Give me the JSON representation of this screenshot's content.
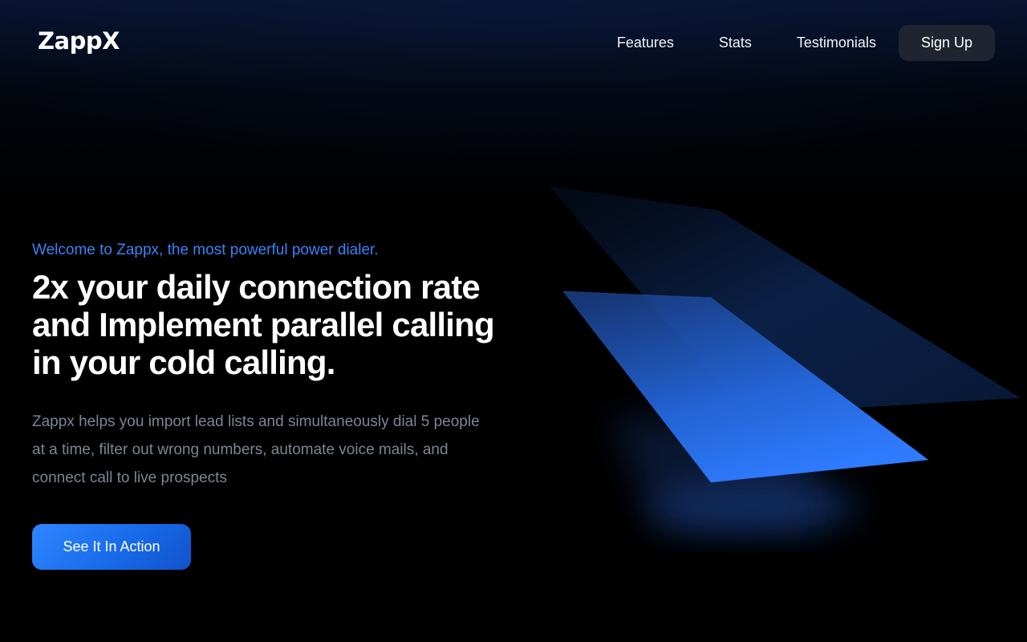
{
  "brand": {
    "name": "ZappX"
  },
  "nav": {
    "links": [
      "Features",
      "Stats",
      "Testimonials"
    ],
    "signup_label": "Sign Up"
  },
  "hero": {
    "tagline": "Welcome to Zappx, the most powerful power dialer.",
    "headline": "2x your daily connection rate and Implement parallel calling in your cold calling.",
    "description": "Zappx helps you import lead lists and simultaneously dial 5 people at a time, filter out wrong numbers, automate voice mails, and connect call to live prospects",
    "cta_label": "See It In Action"
  },
  "colors": {
    "accent": "#3b82f6",
    "button_dark": "#1f2430",
    "muted_text": "#7c8594"
  }
}
